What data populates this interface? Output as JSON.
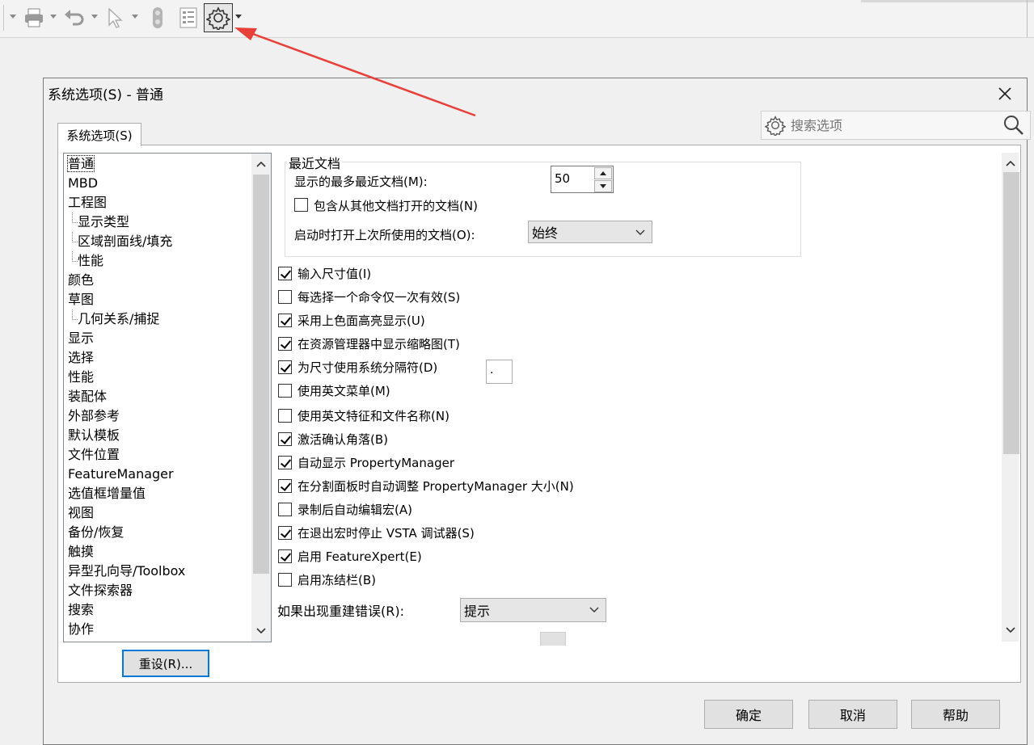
{
  "toolbar": {
    "icons": [
      "print-icon",
      "undo-icon",
      "select-pointer-icon",
      "traffic-light-icon",
      "file-properties-icon",
      "options-gear-icon"
    ]
  },
  "dialog": {
    "title": "系统选项(S) - 普通",
    "close": "✕",
    "search_placeholder": "搜索选项",
    "tab_label": "系统选项(S)",
    "tree": {
      "items": [
        {
          "label": "普通",
          "level": 0,
          "selected": true
        },
        {
          "label": "MBD",
          "level": 0
        },
        {
          "label": "工程图",
          "level": 0
        },
        {
          "label": "显示类型",
          "level": 1
        },
        {
          "label": "区域剖面线/填充",
          "level": 1
        },
        {
          "label": "性能",
          "level": 1
        },
        {
          "label": "颜色",
          "level": 0
        },
        {
          "label": "草图",
          "level": 0
        },
        {
          "label": "几何关系/捕捉",
          "level": 1
        },
        {
          "label": "显示",
          "level": 0
        },
        {
          "label": "选择",
          "level": 0
        },
        {
          "label": "性能",
          "level": 0
        },
        {
          "label": "装配体",
          "level": 0
        },
        {
          "label": "外部参考",
          "level": 0
        },
        {
          "label": "默认模板",
          "level": 0
        },
        {
          "label": "文件位置",
          "level": 0
        },
        {
          "label": "FeatureManager",
          "level": 0
        },
        {
          "label": "选值框增量值",
          "level": 0
        },
        {
          "label": "视图",
          "level": 0
        },
        {
          "label": "备份/恢复",
          "level": 0
        },
        {
          "label": "触摸",
          "level": 0
        },
        {
          "label": "异型孔向导/Toolbox",
          "level": 0
        },
        {
          "label": "文件探索器",
          "level": 0
        },
        {
          "label": "搜索",
          "level": 0
        },
        {
          "label": "协作",
          "level": 0
        }
      ]
    },
    "reset_label": "重设(R)...",
    "recent": {
      "group_title": "最近文档",
      "max_label": "显示的最多最近文档(M):",
      "max_value": "50",
      "include_label": "包含从其他文档打开的文档(N)",
      "include_checked": false,
      "open_last_label": "启动时打开上次所使用的文档(O):",
      "open_last_value": "始终"
    },
    "options": [
      {
        "label": "输入尺寸值(I)",
        "checked": true
      },
      {
        "label": "每选择一个命令仅一次有效(S)",
        "checked": false
      },
      {
        "label": "采用上色面高亮显示(U)",
        "checked": true
      },
      {
        "label": "在资源管理器中显示缩略图(T)",
        "checked": true
      },
      {
        "label": "为尺寸使用系统分隔符(D)",
        "checked": true
      },
      {
        "label": "使用英文菜单(M)",
        "checked": false
      },
      {
        "label": "使用英文特征和文件名称(N)",
        "checked": false
      },
      {
        "label": "激活确认角落(B)",
        "checked": true
      },
      {
        "label": "自动显示 PropertyManager",
        "checked": true
      },
      {
        "label": "在分割面板时自动调整 PropertyManager 大小(N)",
        "checked": true
      },
      {
        "label": "录制后自动编辑宏(A)",
        "checked": false
      },
      {
        "label": "在退出宏时停止 VSTA 调试器(S)",
        "checked": true
      },
      {
        "label": "启用 FeatureXpert(E)",
        "checked": true
      },
      {
        "label": "启用冻结栏(B)",
        "checked": false
      }
    ],
    "separator_value": ".",
    "rebuild_error_label": "如果出现重建错误(R):",
    "rebuild_error_value": "提示",
    "ok_label": "确定",
    "cancel_label": "取消",
    "help_label": "帮助"
  },
  "colors": {
    "focus": "#0078d7",
    "annotation_arrow": "#e8403a"
  }
}
